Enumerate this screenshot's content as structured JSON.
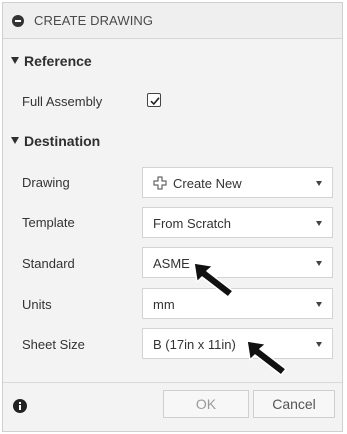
{
  "dialog": {
    "title": "CREATE DRAWING",
    "reference": {
      "heading": "Reference",
      "full_assembly_label": "Full Assembly",
      "full_assembly_checked": true
    },
    "destination": {
      "heading": "Destination",
      "drawing_label": "Drawing",
      "drawing_value": "Create New",
      "template_label": "Template",
      "template_value": "From Scratch",
      "standard_label": "Standard",
      "standard_value": "ASME",
      "units_label": "Units",
      "units_value": "mm",
      "sheet_size_label": "Sheet Size",
      "sheet_size_value": "B (17in x 11in)"
    },
    "footer": {
      "ok_label": "OK",
      "cancel_label": "Cancel"
    }
  },
  "icons": [
    "minus-circle-icon",
    "triangle-down-icon",
    "checkbox-check-icon",
    "create-new-icon",
    "chevron-down-icon",
    "info-icon",
    "pointer-arrow-icon"
  ]
}
